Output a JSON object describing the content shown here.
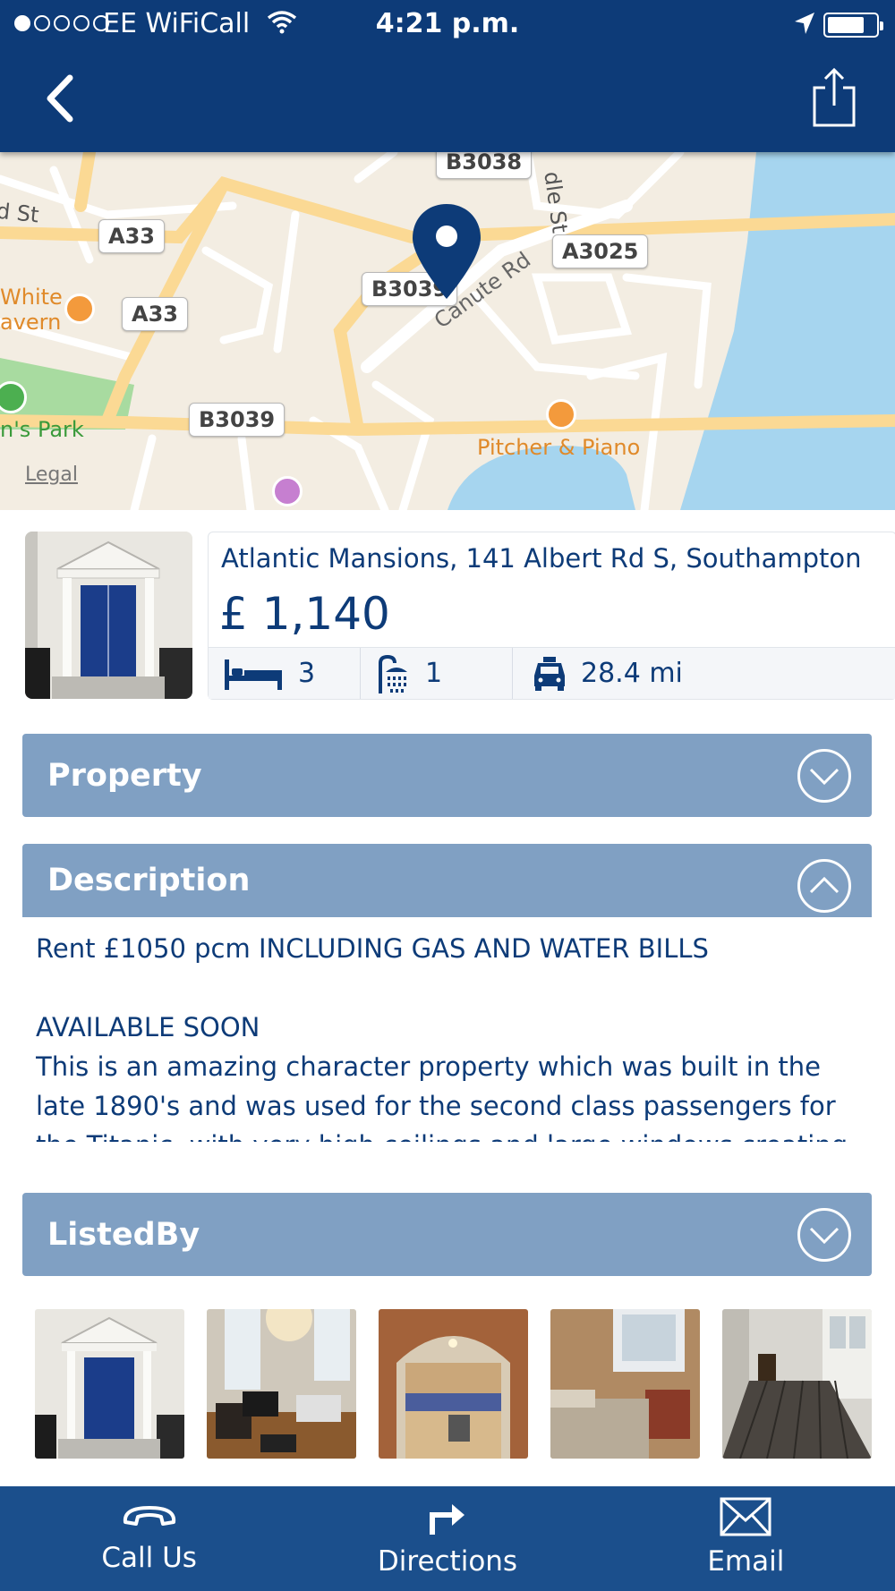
{
  "status_bar": {
    "carrier": "EE WiFiCall",
    "time": "4:21 p.m."
  },
  "map": {
    "road_labels": {
      "b3038": "B3038",
      "a33_top": "A33",
      "a33_mid": "A33",
      "a3025": "A3025",
      "b3039_mid": "B3039",
      "b3039_bottom": "B3039"
    },
    "street_labels": {
      "st_left": "d St",
      "dle_st": "dle St",
      "canute_rd": "Canute Rd"
    },
    "places": {
      "white_tavern_line1": "White",
      "white_tavern_line2": "avern",
      "park": "n's Park",
      "pitcher_piano": "Pitcher & Piano"
    },
    "legal": "Legal"
  },
  "listing": {
    "address": "Atlantic Mansions, 141 Albert Rd S, Southampton",
    "price": "£ 1,140",
    "bedrooms": "3",
    "bathrooms": "1",
    "distance": "28.4 mi"
  },
  "sections": {
    "property": "Property",
    "description": "Description",
    "listed_by": "ListedBy"
  },
  "description": {
    "line1": "Rent £1050 pcm INCLUDING GAS AND WATER BILLS",
    "line2": "AVAILABLE SOON",
    "body": "This is an amazing character property which was built in the late 1890's and was used for the second class passengers for the Titanic, with very high ceilings and large windows creating"
  },
  "bottom_bar": {
    "call": "Call Us",
    "directions": "Directions",
    "email": "Email"
  },
  "colors": {
    "navy": "#0d3b78",
    "accordion": "#80a0c3",
    "bottom_bar": "#1b4f8c"
  }
}
